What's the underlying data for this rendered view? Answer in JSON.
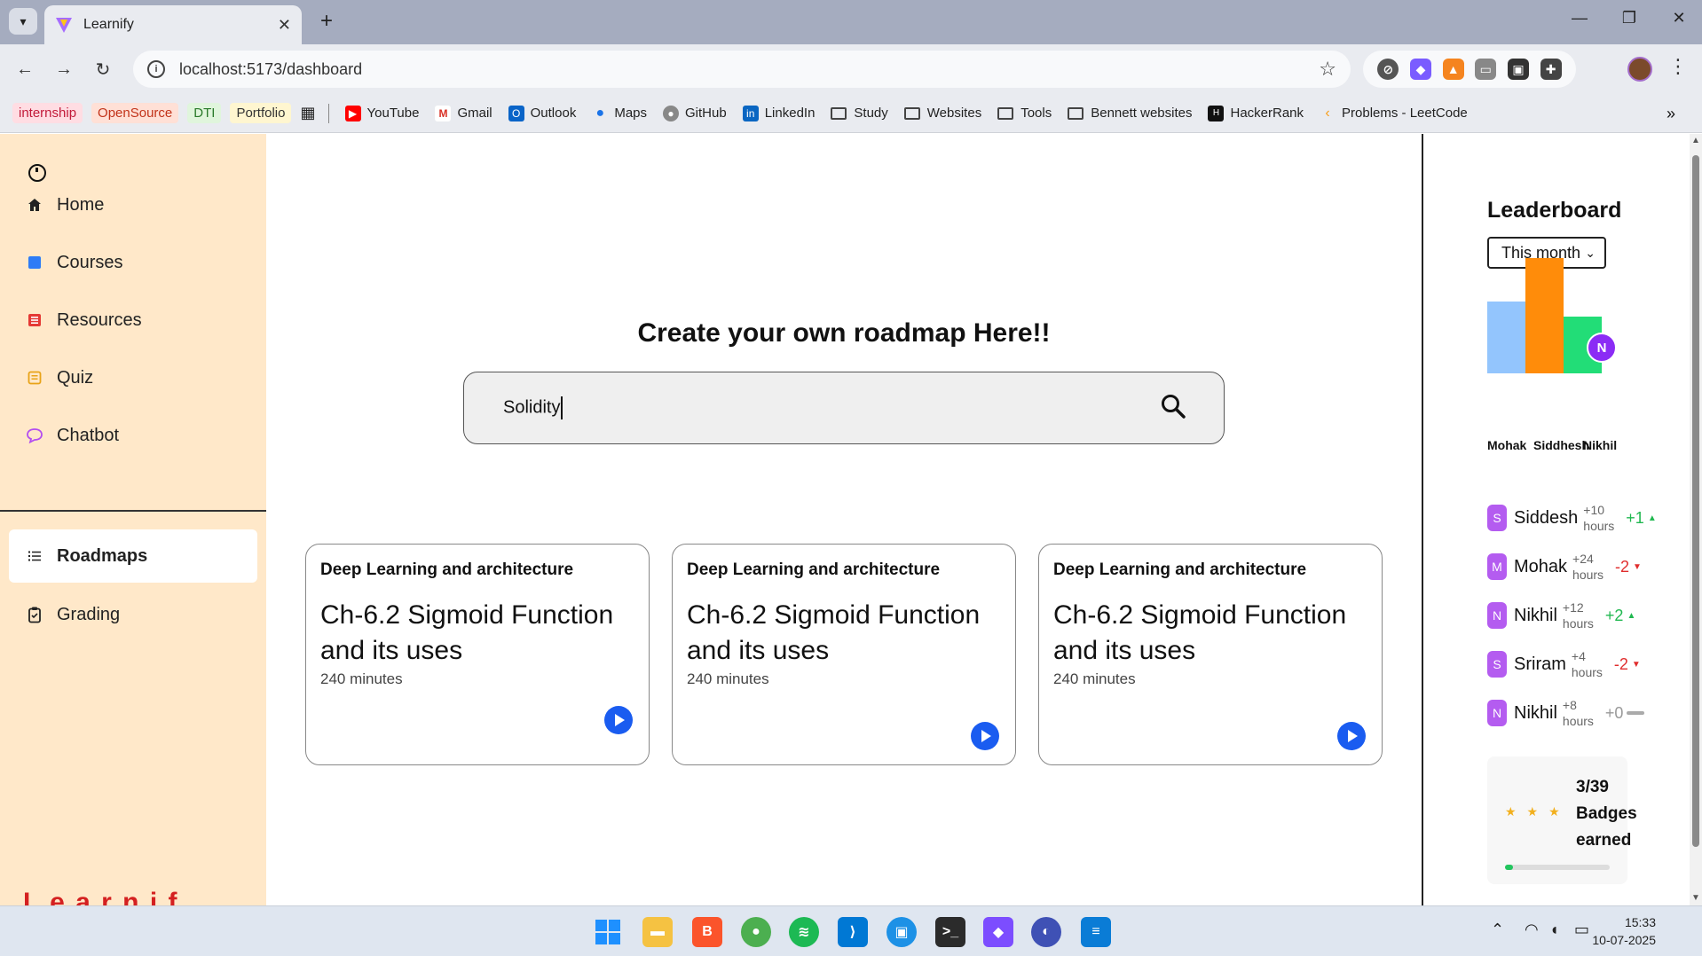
{
  "browser": {
    "tab_title": "Learnify",
    "url": "localhost:5173/dashboard",
    "bookmarks": {
      "chips": [
        {
          "label": "internship",
          "color": "#c21a3a",
          "bg": "#ffdde3"
        },
        {
          "label": "OpenSource",
          "color": "#c2331a",
          "bg": "#ffe0d6"
        },
        {
          "label": "DTI",
          "color": "#2a7a2a",
          "bg": "#e0f5dc"
        },
        {
          "label": "Portfolio",
          "color": "#333333",
          "bg": "#fff6d0"
        }
      ],
      "links": [
        "YouTube",
        "Gmail",
        "Outlook",
        "Maps",
        "GitHub",
        "LinkedIn"
      ],
      "folders": [
        "Study",
        "Websites",
        "Tools",
        "Bennett websites"
      ],
      "extra": [
        "HackerRank",
        "Problems - LeetCode"
      ]
    }
  },
  "sidebar": {
    "items": [
      {
        "label": "Home",
        "icon": "home-icon"
      },
      {
        "label": "Courses",
        "icon": "square-icon"
      },
      {
        "label": "Resources",
        "icon": "list-box-icon"
      },
      {
        "label": "Quiz",
        "icon": "note-icon"
      },
      {
        "label": "Chatbot",
        "icon": "chat-bubble-icon"
      },
      {
        "label": "Roadmaps",
        "icon": "list-icon"
      },
      {
        "label": "Grading",
        "icon": "clipboard-icon"
      }
    ],
    "active": "Roadmaps"
  },
  "main": {
    "heading": "Create your own roadmap Here!!",
    "search_value": "Solidity",
    "cards": [
      {
        "category": "Deep Learning and architecture",
        "title": "Ch-6.2 Sigmoid Function and its uses",
        "duration": "240 minutes"
      },
      {
        "category": "Deep Learning and architecture",
        "title": "Ch-6.2 Sigmoid Function and its uses",
        "duration": "240 minutes"
      },
      {
        "category": "Deep Learning and architecture",
        "title": "Ch-6.2 Sigmoid Function and its uses",
        "duration": "240 minutes"
      }
    ]
  },
  "leaderboard": {
    "title": "Leaderboard",
    "period": "This month",
    "bars": [
      {
        "name": "Mohak",
        "value": 0.62,
        "color": "#93c5fd"
      },
      {
        "name": "Siddhesh",
        "value": 1.0,
        "color": "#ff8c0a"
      },
      {
        "name": "Nikhil",
        "value": 0.49,
        "color": "#22dd77"
      }
    ],
    "bar_avatar": "N",
    "rows": [
      {
        "initial": "S",
        "name": "Siddesh",
        "hours_top": "+10",
        "hours_bottom": "hours",
        "delta": "+1",
        "trend": "up"
      },
      {
        "initial": "M",
        "name": "Mohak",
        "hours_top": "+24",
        "hours_bottom": "hours",
        "delta": "-2",
        "trend": "down"
      },
      {
        "initial": "N",
        "name": "Nikhil",
        "hours_top": "+12",
        "hours_bottom": "hours",
        "delta": "+2",
        "trend": "up"
      },
      {
        "initial": "S",
        "name": "Sriram",
        "hours_top": "+4",
        "hours_bottom": "hours",
        "delta": "-2",
        "trend": "down"
      },
      {
        "initial": "N",
        "name": "Nikhil",
        "hours_top": "+8",
        "hours_bottom": "hours",
        "delta": "+0",
        "trend": "neutral"
      }
    ],
    "badges": {
      "count": "3/39",
      "line2": "Badges",
      "line3": "earned",
      "progress": 0.077
    }
  },
  "taskbar": {
    "time": "15:33",
    "date": "10-07-2025"
  }
}
